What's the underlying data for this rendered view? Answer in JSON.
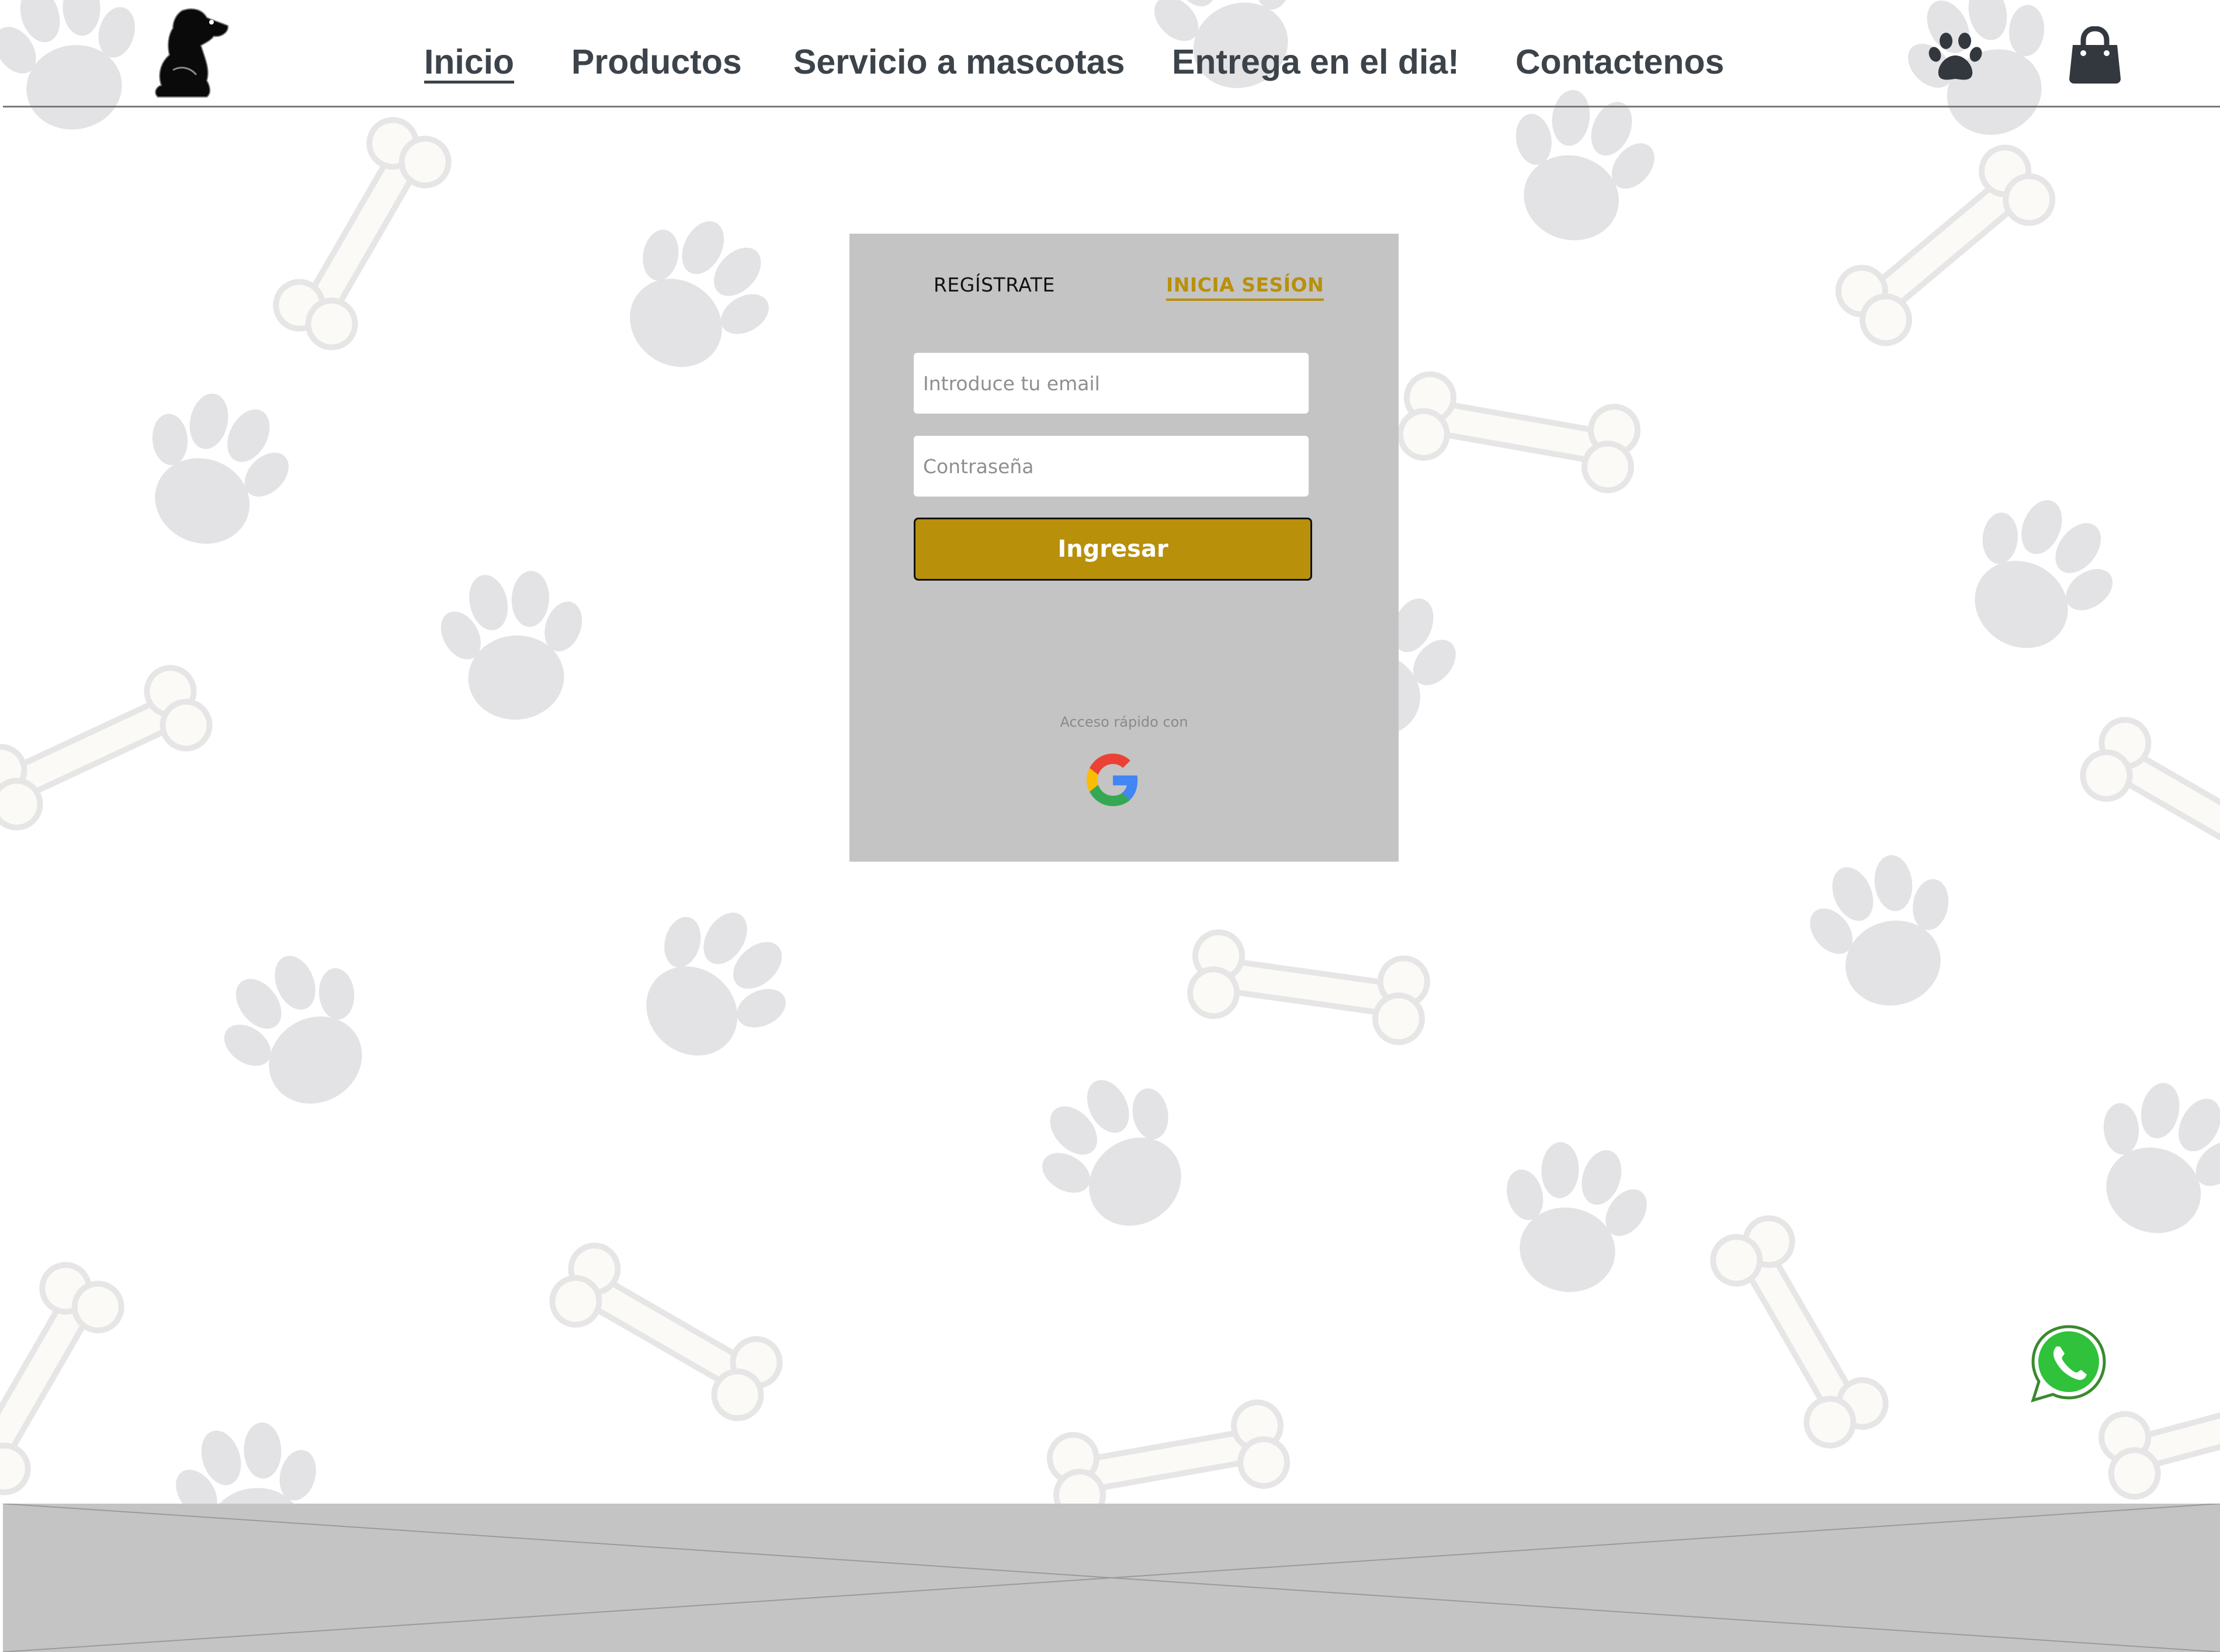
{
  "nav": {
    "items": [
      {
        "label": "Inicio",
        "active": true
      },
      {
        "label": "Productos",
        "active": false
      },
      {
        "label": "Servicio a mascotas",
        "active": false
      },
      {
        "label": "Entrega en el dia!",
        "active": false
      },
      {
        "label": "Contactenos",
        "active": false
      }
    ],
    "icons": [
      "dog-logo-icon",
      "paw-icon",
      "shopping-bag-icon"
    ]
  },
  "login": {
    "tabs": {
      "register": "REGÍSTRATE",
      "login": "INICIA SESÍON"
    },
    "active_tab": "login",
    "email": {
      "placeholder": "Introduce tu email",
      "value": ""
    },
    "password": {
      "placeholder": "Contraseña",
      "value": ""
    },
    "submit_label": "Ingresar",
    "quick_access_label": "Acceso rápido con",
    "quick_access_icon": "google-icon"
  },
  "floating": {
    "icon": "whatsapp-icon"
  },
  "colors": {
    "accent": "#b8900a",
    "card_bg": "#c4c4c4",
    "nav_text": "#3c434a",
    "paw_pattern": "#e3e3e5",
    "bone_pattern": "#fbfaf7"
  }
}
